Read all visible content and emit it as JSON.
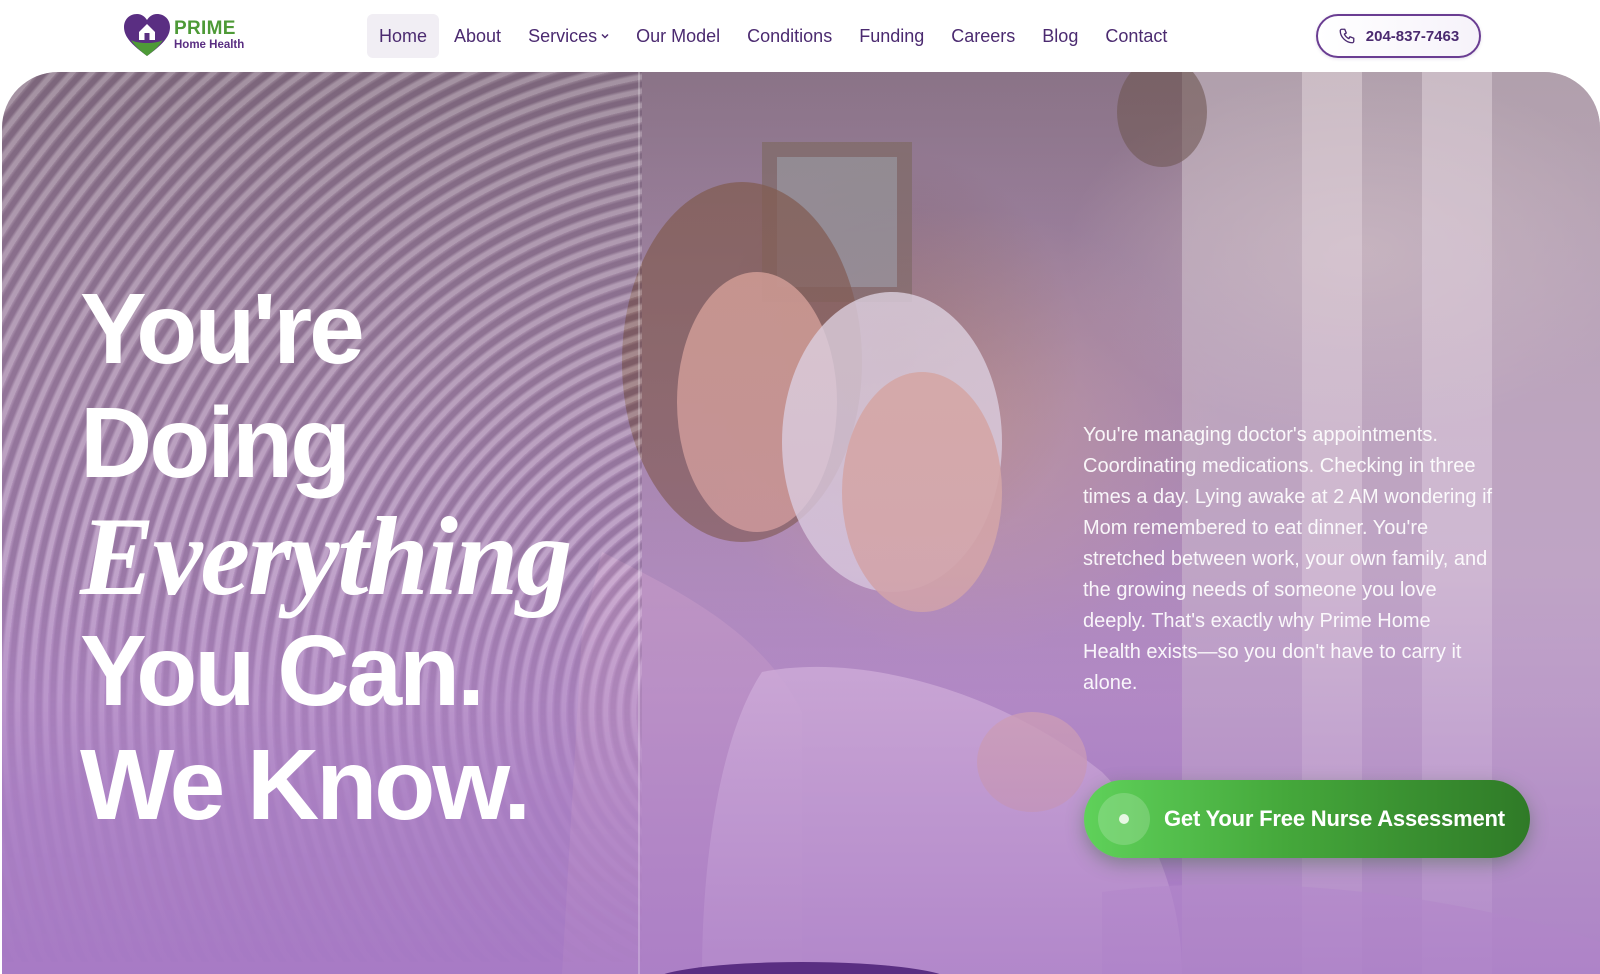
{
  "brand": {
    "name": "PRIME",
    "tagline": "Home Health",
    "colors": {
      "purple": "#5a2e82",
      "green": "#4e9a37",
      "cta_green": "#45a83b"
    }
  },
  "nav": {
    "items": [
      {
        "label": "Home",
        "active": true
      },
      {
        "label": "About"
      },
      {
        "label": "Services",
        "has_dropdown": true
      },
      {
        "label": "Our Model"
      },
      {
        "label": "Conditions"
      },
      {
        "label": "Funding"
      },
      {
        "label": "Careers"
      },
      {
        "label": "Blog"
      },
      {
        "label": "Contact"
      }
    ]
  },
  "header": {
    "phone": "204-837-7463",
    "phone_icon": "phone-icon"
  },
  "hero": {
    "headline": {
      "line1": "You're",
      "line2": "Doing",
      "line3": "Everything",
      "line4": "You Can.",
      "line5": "We Know."
    },
    "body": "You're managing doctor's appointments. Coordinating medications. Checking in three times a day. Lying awake at 2 AM wondering if Mom remembered to eat dinner. You're stretched between work, your own family, and the growing needs of someone you love deeply. That's exactly why Prime Home Health exists—so you don't have to carry it alone.",
    "cta": "Get Your Free Nurse Assessment"
  }
}
